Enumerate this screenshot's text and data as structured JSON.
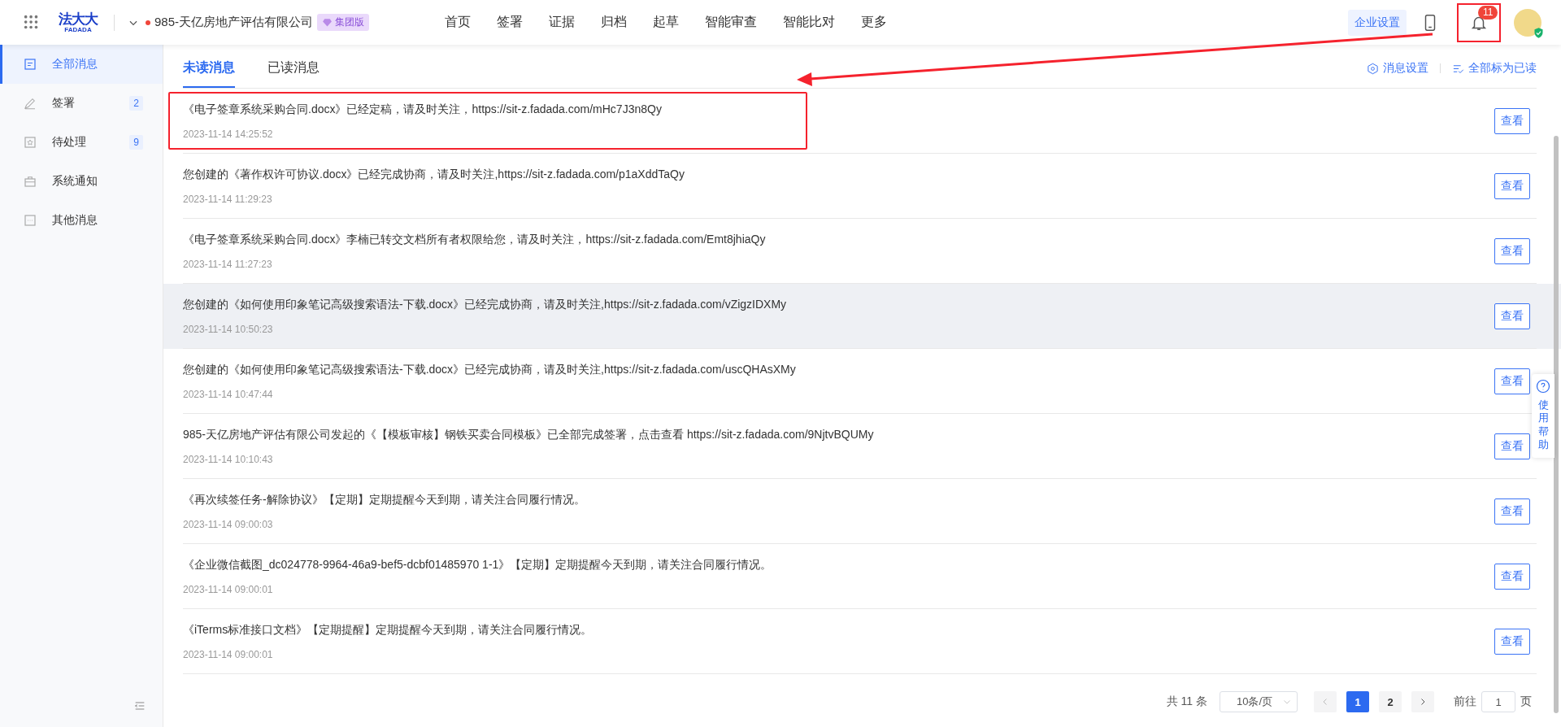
{
  "header": {
    "logo": {
      "name": "法大大",
      "latin": "FADADA"
    },
    "company": "985-天亿房地产评估有限公司",
    "edition_badge": "集团版",
    "nav": [
      {
        "label": "首页"
      },
      {
        "label": "签署"
      },
      {
        "label": "证据"
      },
      {
        "label": "归档"
      },
      {
        "label": "起草"
      },
      {
        "label": "智能审查"
      },
      {
        "label": "智能比对"
      },
      {
        "label": "更多"
      }
    ],
    "settings_button": "企业设置",
    "notification_count": "11",
    "notification_annotated": true
  },
  "sidebar": {
    "items": [
      {
        "label": "全部消息",
        "kind": "doc",
        "selected": true
      },
      {
        "label": "签署",
        "kind": "pen",
        "count": "2",
        "selected": false
      },
      {
        "label": "待处理",
        "kind": "star",
        "count": "9",
        "selected": false
      },
      {
        "label": "系统通知",
        "kind": "case",
        "selected": false
      },
      {
        "label": "其他消息",
        "kind": "dots",
        "selected": false
      }
    ]
  },
  "tabs": [
    {
      "label": "未读消息",
      "selected": true
    },
    {
      "label": "已读消息",
      "selected": false
    }
  ],
  "actions": [
    {
      "label": "消息设置",
      "kind": "settings"
    },
    {
      "label": "全部标为已读",
      "kind": "mark-read"
    }
  ],
  "messages": [
    {
      "text": "《电子签章系统采购合同.docx》已经定稿，请及时关注，https://sit-z.fadada.com/mHc7J3n8Qy",
      "time": "2023-11-14 14:25:52",
      "button": "查看",
      "highlighted": false,
      "annotated": true
    },
    {
      "text": "您创建的《著作权许可协议.docx》已经完成协商，请及时关注,https://sit-z.fadada.com/p1aXddTaQy",
      "time": "2023-11-14 11:29:23",
      "button": "查看",
      "highlighted": false,
      "annotated": false
    },
    {
      "text": "《电子签章系统采购合同.docx》李楠已转交文档所有者权限给您，请及时关注，https://sit-z.fadada.com/Emt8jhiaQy",
      "time": "2023-11-14 11:27:23",
      "button": "查看",
      "highlighted": false,
      "annotated": false
    },
    {
      "text": "您创建的《如何使用印象笔记高级搜索语法-下载.docx》已经完成协商，请及时关注,https://sit-z.fadada.com/vZigzIDXMy",
      "time": "2023-11-14 10:50:23",
      "button": "查看",
      "highlighted": true,
      "annotated": false
    },
    {
      "text": "您创建的《如何使用印象笔记高级搜索语法-下载.docx》已经完成协商，请及时关注,https://sit-z.fadada.com/uscQHAsXMy",
      "time": "2023-11-14 10:47:44",
      "button": "查看",
      "highlighted": false,
      "annotated": false
    },
    {
      "text": "985-天亿房地产评估有限公司发起的《【模板审核】钢铁买卖合同模板》已全部完成签署，点击查看 https://sit-z.fadada.com/9NjtvBQUMy",
      "time": "2023-11-14 10:10:43",
      "button": "查看",
      "highlighted": false,
      "annotated": false
    },
    {
      "text": "《再次续签任务-解除协议》【定期】定期提醒今天到期，请关注合同履行情况。",
      "time": "2023-11-14 09:00:03",
      "button": "查看",
      "highlighted": false,
      "annotated": false
    },
    {
      "text": "《企业微信截图_dc024778-9964-46a9-bef5-dcbf01485970 1-1》【定期】定期提醒今天到期，请关注合同履行情况。",
      "time": "2023-11-14 09:00:01",
      "button": "查看",
      "highlighted": false,
      "annotated": false
    },
    {
      "text": "《iTerms标准接口文档》【定期提醒】定期提醒今天到期，请关注合同履行情况。",
      "time": "2023-11-14 09:00:01",
      "button": "查看",
      "highlighted": false,
      "annotated": false
    }
  ],
  "pagination": {
    "total": "共 11 条",
    "page_size": "10条/页",
    "pages": [
      {
        "label": "1",
        "selected": true
      },
      {
        "label": "2",
        "selected": false
      }
    ],
    "goto_label": "前往",
    "goto_value": "1",
    "goto_suffix": "页"
  },
  "help": {
    "label": "使用帮助"
  }
}
